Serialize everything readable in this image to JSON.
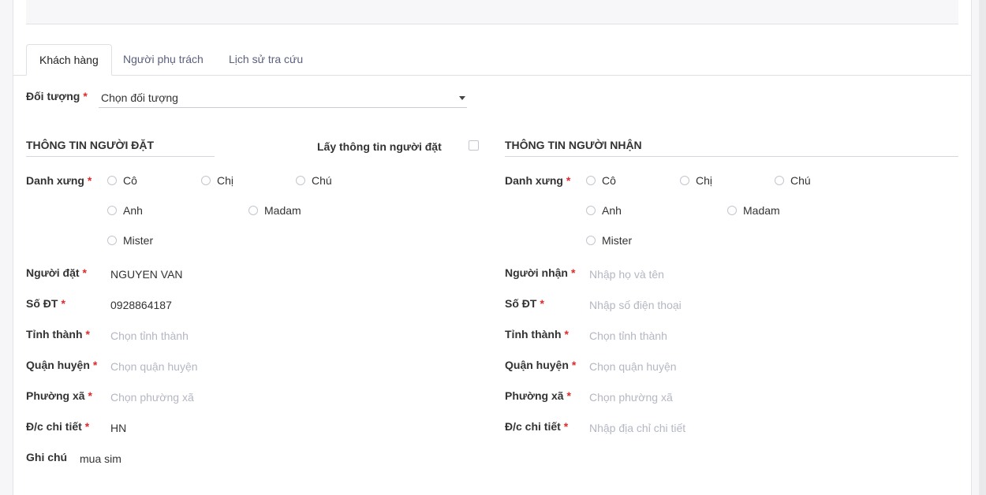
{
  "tabs": [
    {
      "label": "Khách hàng"
    },
    {
      "label": "Người phụ trách"
    },
    {
      "label": "Lịch sử tra cứu"
    }
  ],
  "object_field": {
    "label": "Đối tượng",
    "required": "*",
    "value": "Chọn đối tượng"
  },
  "sender": {
    "title": "THÔNG TIN NGƯỜI ĐẶT",
    "salutation_label": "Danh xưng",
    "salutations": [
      "Cô",
      "Chị",
      "Chú",
      "Anh",
      "Madam",
      "Mister"
    ],
    "name_label": "Người đặt",
    "name_value": "NGUYEN VAN",
    "phone_label": "Số ĐT",
    "phone_value": "0928864187",
    "province_label": "Tỉnh thành",
    "province_placeholder": "Chọn tỉnh thành",
    "district_label": "Quận huyện",
    "district_placeholder": "Chọn quận huyện",
    "ward_label": "Phường xã",
    "ward_placeholder": "Chọn phường xã",
    "address_label": "Đ/c chi tiết",
    "address_value": "HN",
    "note_label": "Ghi chú",
    "note_value": "mua sim"
  },
  "copy_sender": {
    "label": "Lấy thông tin người đặt",
    "checked": false
  },
  "receiver": {
    "title": "THÔNG TIN NGƯỜI NHẬN",
    "salutation_label": "Danh xưng",
    "salutations": [
      "Cô",
      "Chị",
      "Chú",
      "Anh",
      "Madam",
      "Mister"
    ],
    "name_label": "Người nhận",
    "name_placeholder": "Nhập họ và tên",
    "phone_label": "Số ĐT",
    "phone_placeholder": "Nhập số điện thoại",
    "province_label": "Tỉnh thành",
    "province_placeholder": "Chọn tỉnh thành",
    "district_label": "Quận huyện",
    "district_placeholder": "Chọn quận huyện",
    "ward_label": "Phường xã",
    "ward_placeholder": "Chọn phường xã",
    "address_label": "Đ/c chi tiết",
    "address_placeholder": "Nhập địa chỉ chi tiết"
  },
  "required_mark": "*",
  "colors": {
    "required": "#e0292b",
    "placeholder": "#b4b7c2",
    "tab_text": "#5a5f7d"
  }
}
